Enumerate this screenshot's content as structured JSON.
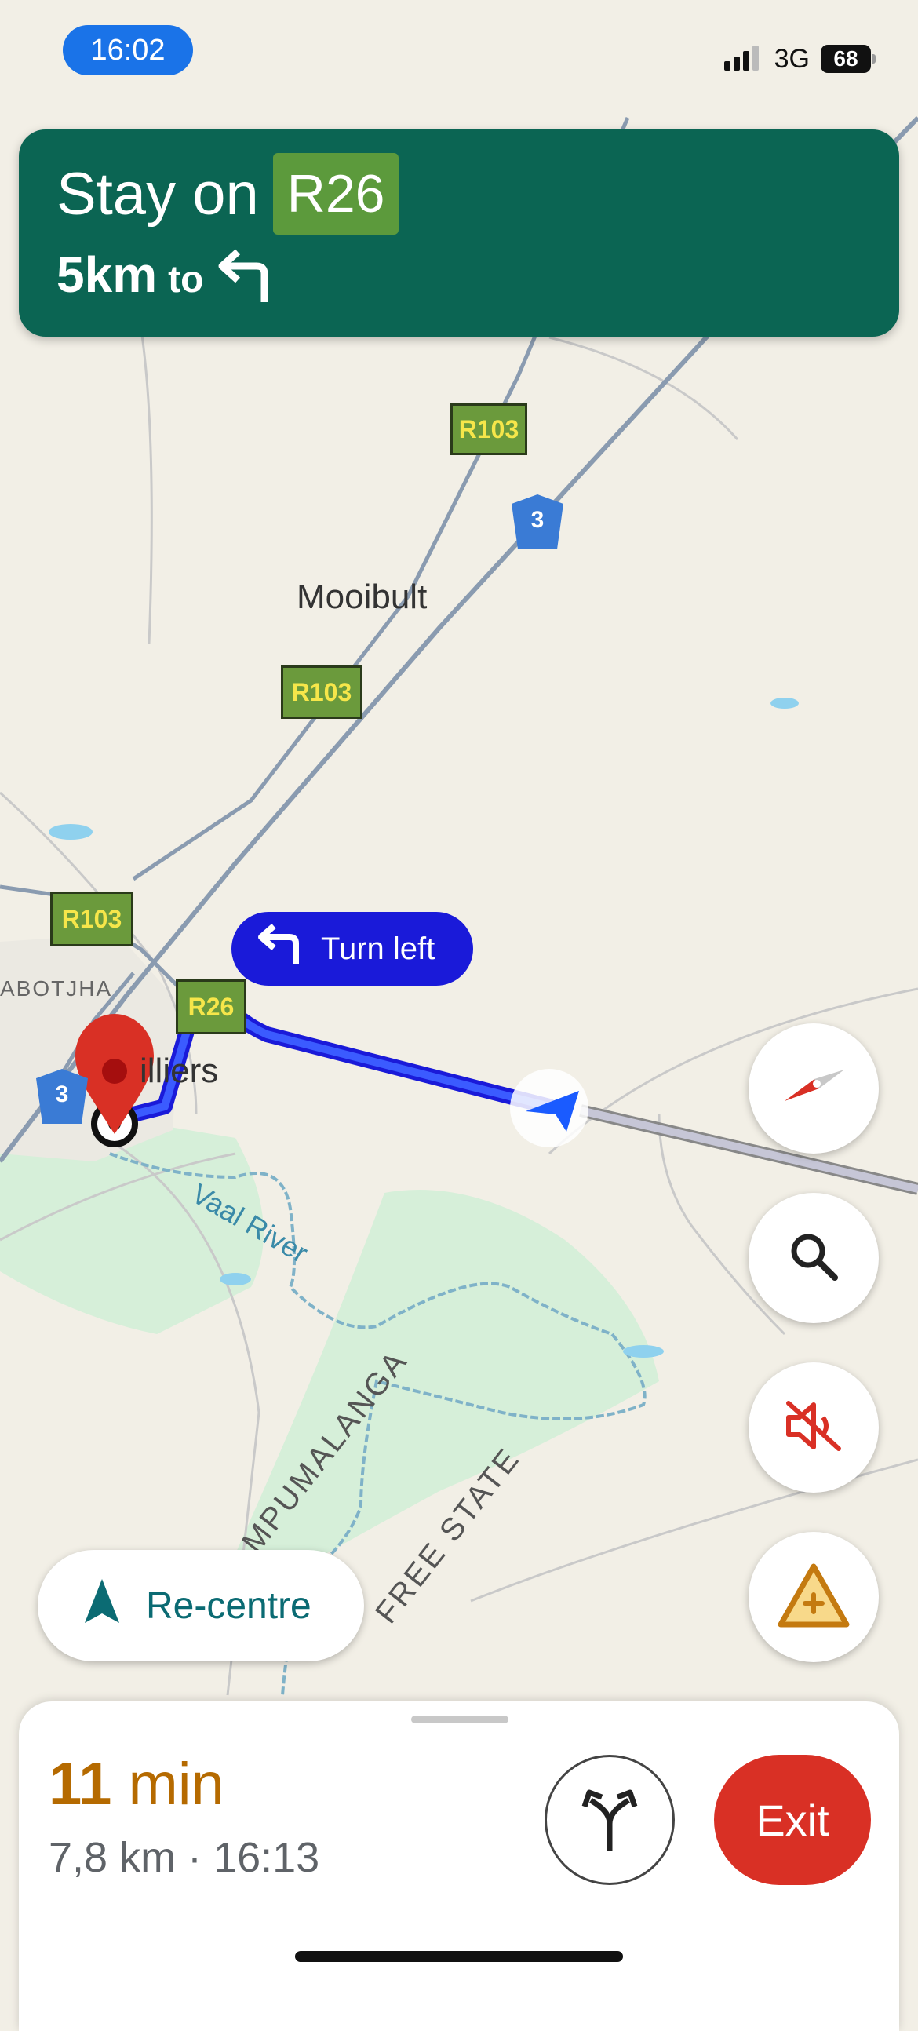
{
  "status_bar": {
    "time": "16:02",
    "network": "3G",
    "battery": "68"
  },
  "nav_banner": {
    "instruction": "Stay on",
    "route": "R26",
    "distance": "5km",
    "to_word": "to"
  },
  "map": {
    "places": {
      "mooibult": "Mooibult",
      "villiers": "illiers",
      "township": "ABOTJHA",
      "river": "Vaal River",
      "province_1": "MPUMALANGA",
      "province_2": "FREE STATE"
    },
    "shields": {
      "r103_a": "R103",
      "r103_b": "R103",
      "r103_c": "R103",
      "r26": "R26",
      "n3_a": "3",
      "n3_b": "3"
    },
    "turn_bubble": "Turn left"
  },
  "controls": {
    "recentre_label": "Re-centre"
  },
  "trip": {
    "minutes": "11",
    "min_unit": "min",
    "details": "7,8 km · 16:13",
    "exit_label": "Exit"
  },
  "colors": {
    "banner": "#0b6553",
    "route": "#1a1ad9",
    "exit": "#d93025",
    "eta": "#b56a00"
  }
}
